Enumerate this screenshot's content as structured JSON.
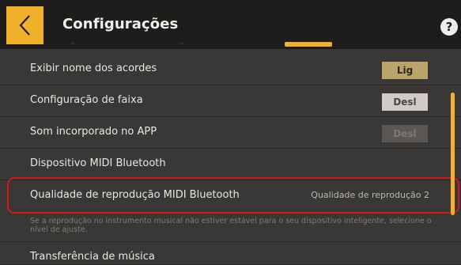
{
  "header": {
    "title": "Configurações",
    "back_icon": "chevron-left-icon",
    "help_icon": "question-circle-icon",
    "help_glyph": "?",
    "accent": "#f2b12a"
  },
  "rows": [
    {
      "label": "Exibir nome dos acordes",
      "toggle": "Lig",
      "state": "on"
    },
    {
      "label": "Configuração de faixa",
      "toggle": "Desl",
      "state": "off"
    },
    {
      "label": "Som incorporado no APP",
      "toggle": "Desl",
      "state": "disabled"
    },
    {
      "label": "Dispositivo MIDI Bluetooth"
    },
    {
      "label": "Qualidade de reprodução MIDI Bluetooth",
      "value": "Qualidade de reprodução 2"
    },
    {
      "label": "Transferência de música"
    }
  ],
  "description": "Se a reprodução no instrumento musical não estiver estável para o seu dispositivo inteligente, selecione o nível de ajuste.",
  "highlight_color": "#d8161c"
}
